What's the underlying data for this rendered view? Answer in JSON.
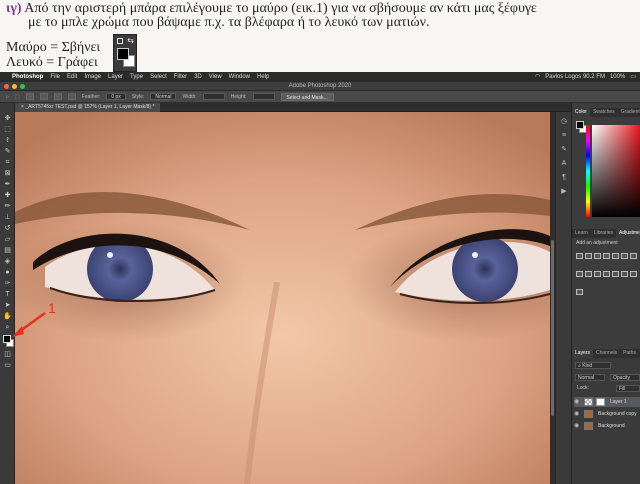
{
  "document": {
    "marker": "ιγ)",
    "instruction_line1": "Από την αριστερή μπάρα επιλέγουμε το μαύρο (εικ.1) για να σβήσουμε αν κάτι μας ξέφυγε",
    "instruction_line2": "με το μπλε χρώμα που βάψαμε π.χ. τα βλέφαρα ή το λευκό των ματιών.",
    "legend_black": "Μαύρο = Σβήνει",
    "legend_white": "Λευκό = Γράφει",
    "annotation_label": "1"
  },
  "menubar": {
    "items": [
      "Photoshop",
      "File",
      "Edit",
      "Image",
      "Layer",
      "Type",
      "Select",
      "Filter",
      "3D",
      "View",
      "Window",
      "Help"
    ],
    "right": [
      "Pavlos Logos 90.2 FM",
      "100%"
    ]
  },
  "window": {
    "title": "Adobe Photoshop 2020"
  },
  "options": {
    "feather_label": "Feather:",
    "feather_value": "0 px",
    "style_label": "Style:",
    "style_value": "Normal",
    "width_label": "Width:",
    "height_label": "Height:",
    "select_mask_button": "Select and Mask..."
  },
  "document_tab": {
    "label": "_ART5745xr TEST.psd @ 157% (Layer 1, Layer Mask/8) *"
  },
  "panels": {
    "color_tabs": [
      "Color",
      "Swatches",
      "Gradients"
    ],
    "adjust_tabs": [
      "Learn",
      "Libraries",
      "Adjustments"
    ],
    "adjust_label": "Add an adjustment",
    "layers_tabs": [
      "Layers",
      "Channels",
      "Paths"
    ],
    "kind_label": "Kind",
    "blend_value": "Normal",
    "opacity_label": "Opacity",
    "lock_label": "Lock:",
    "fill_label": "Fill",
    "layers": [
      "Layer 1",
      "Background copy",
      "Background"
    ]
  },
  "colors": {
    "accent_red": "#e8301c",
    "foreground": "#000000",
    "background": "#ffffff",
    "iris": "#4b5385"
  }
}
